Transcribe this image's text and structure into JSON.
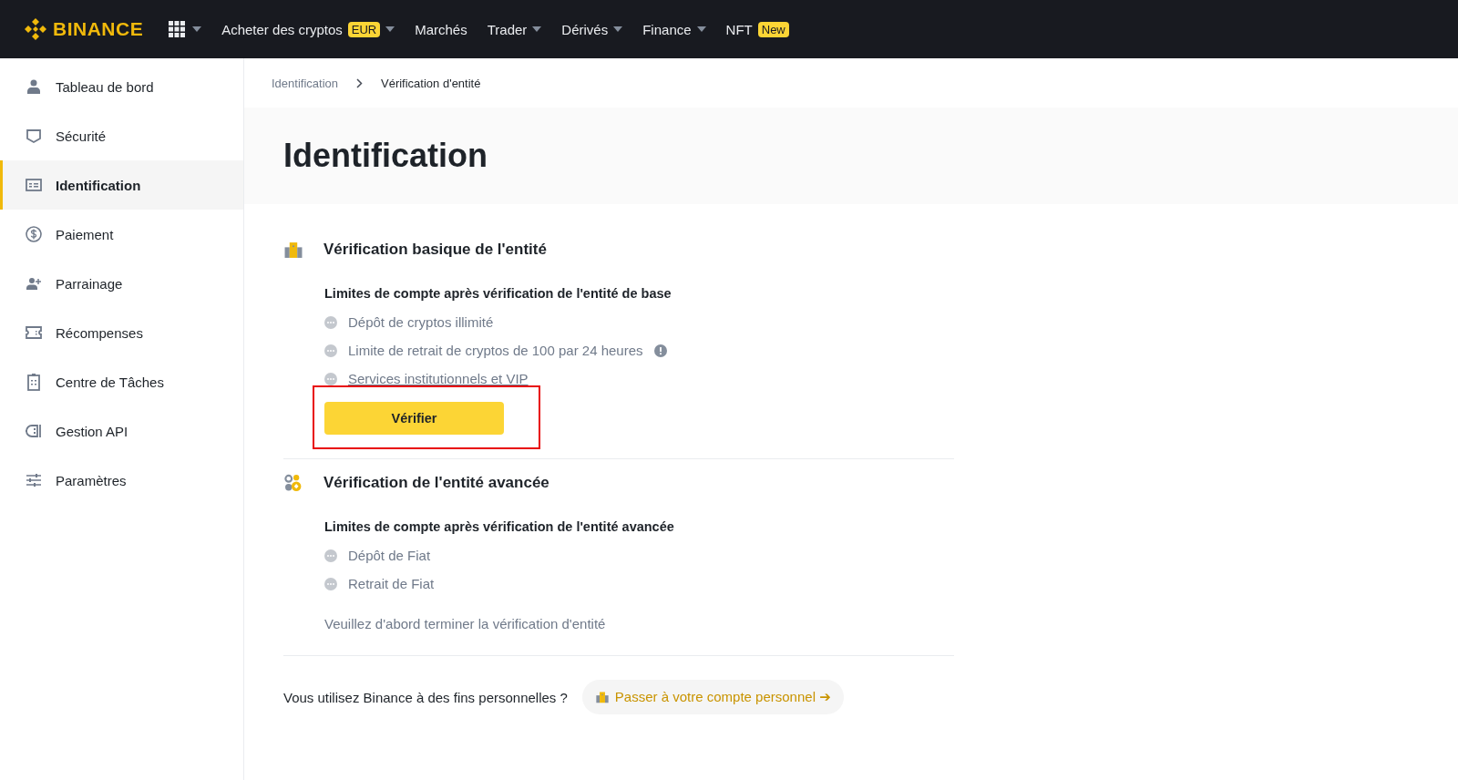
{
  "topbar": {
    "logo": "BINANCE",
    "nav": [
      {
        "label": "Acheter des cryptos",
        "badge": "EUR",
        "dropdown": true
      },
      {
        "label": "Marchés",
        "dropdown": false
      },
      {
        "label": "Trader",
        "dropdown": true
      },
      {
        "label": "Dérivés",
        "dropdown": true
      },
      {
        "label": "Finance",
        "dropdown": true
      },
      {
        "label": "NFT",
        "badge": "New",
        "dropdown": false
      }
    ]
  },
  "sidebar": {
    "items": [
      {
        "label": "Tableau de bord",
        "selected": false
      },
      {
        "label": "Sécurité",
        "selected": false
      },
      {
        "label": "Identification",
        "selected": true
      },
      {
        "label": "Paiement",
        "selected": false
      },
      {
        "label": "Parrainage",
        "selected": false
      },
      {
        "label": "Récompenses",
        "selected": false
      },
      {
        "label": "Centre de Tâches",
        "selected": false
      },
      {
        "label": "Gestion API",
        "selected": false
      },
      {
        "label": "Paramètres",
        "selected": false
      }
    ]
  },
  "breadcrumb": [
    "Identification",
    "Vérification d'entité"
  ],
  "page_title": "Identification",
  "sections": [
    {
      "title": "Vérification basique de l'entité",
      "limits_title": "Limites de compte après vérification de l'entité de base",
      "limits": [
        {
          "text": "Dépôt de cryptos illimité",
          "kind": "plain"
        },
        {
          "text": "Limite de retrait de cryptos de 100 par 24 heures",
          "kind": "info"
        },
        {
          "text": "Services institutionnels et VIP",
          "kind": "link"
        }
      ],
      "button": {
        "label": "Vérifier",
        "highlighted": true
      }
    },
    {
      "title": "Vérification de l'entité avancée",
      "limits_title": "Limites de compte après vérification de l'entité avancée",
      "limits": [
        {
          "text": "Dépôt de Fiat",
          "kind": "plain"
        },
        {
          "text": "Retrait de Fiat",
          "kind": "plain"
        }
      ],
      "note": "Veuillez d'abord terminer la vérification d'entité"
    }
  ],
  "footer": {
    "question": "Vous utilisez Binance à des fins personnelles ?",
    "link": "Passer à votre compte personnel ➔"
  }
}
